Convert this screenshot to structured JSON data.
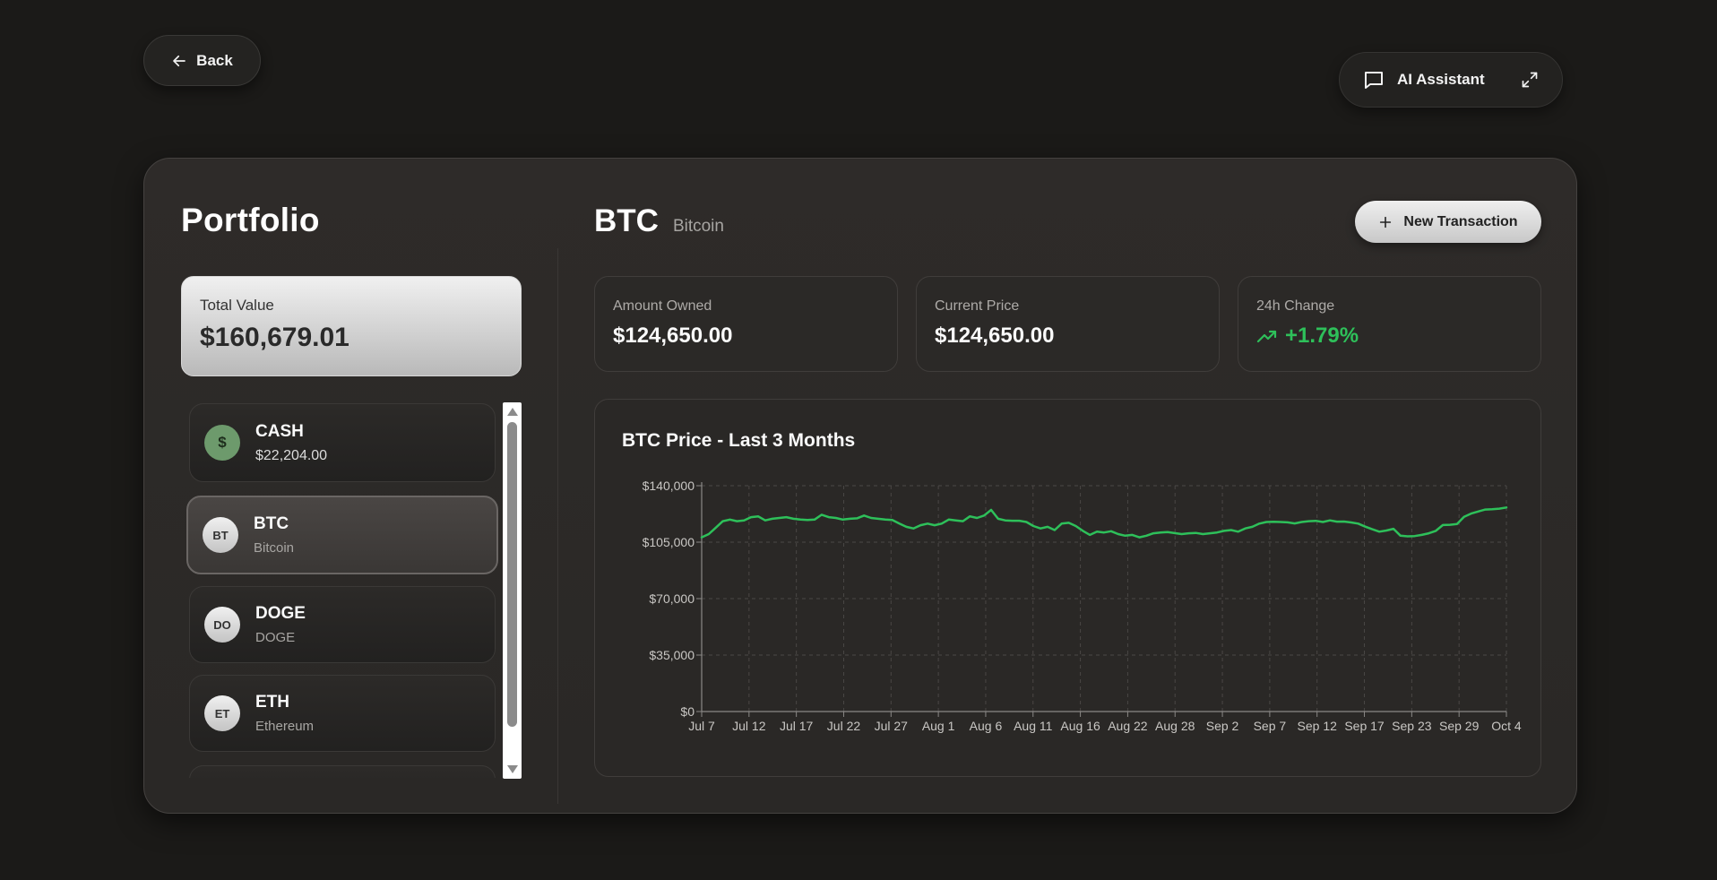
{
  "header": {
    "back_label": "Back",
    "ai_assistant_label": "AI Assistant"
  },
  "portfolio": {
    "title": "Portfolio",
    "total_label": "Total Value",
    "total_value": "$160,679.01",
    "assets": [
      {
        "icon": "$",
        "name": "CASH",
        "sub": "$22,204.00"
      },
      {
        "icon": "BT",
        "name": "BTC",
        "sub": "Bitcoin",
        "selected": true
      },
      {
        "icon": "DO",
        "name": "DOGE",
        "sub": "DOGE"
      },
      {
        "icon": "ET",
        "name": "ETH",
        "sub": "Ethereum"
      }
    ]
  },
  "coin": {
    "symbol": "BTC",
    "name": "Bitcoin",
    "new_transaction_label": "New Transaction"
  },
  "stats": {
    "amount_owned_label": "Amount Owned",
    "amount_owned_value": "$124,650.00",
    "current_price_label": "Current Price",
    "current_price_value": "$124,650.00",
    "change_label": "24h Change",
    "change_value": "+1.79%"
  },
  "colors": {
    "accent_green": "#2ec05a",
    "chart_line": "#2ec05a"
  },
  "chart_data": {
    "type": "line",
    "title": "BTC Price - Last 3 Months",
    "xlabel": "",
    "ylabel": "",
    "ylim": [
      0,
      140000
    ],
    "yticks": [
      {
        "value": 0,
        "label": "$0"
      },
      {
        "value": 35000,
        "label": "$35,000"
      },
      {
        "value": 70000,
        "label": "$70,000"
      },
      {
        "value": 105000,
        "label": "$105,000"
      },
      {
        "value": 140000,
        "label": "$140,000"
      }
    ],
    "xticks": [
      "Jul 7",
      "Jul 12",
      "Jul 17",
      "Jul 22",
      "Jul 27",
      "Aug 1",
      "Aug 6",
      "Aug 11",
      "Aug 16",
      "Aug 22",
      "Aug 28",
      "Sep 2",
      "Sep 7",
      "Sep 12",
      "Sep 17",
      "Sep 23",
      "Sep 29",
      "Oct 4"
    ],
    "grid": true,
    "series": [
      {
        "values": [
          108000,
          110000,
          114000,
          118000,
          119000,
          118000,
          118500,
          120500,
          121000,
          118500,
          119500,
          120000,
          120500,
          119500,
          119000,
          118800,
          119000,
          122000,
          120500,
          120000,
          119000,
          119500,
          119800,
          121500,
          120000,
          119500,
          119000,
          118700,
          116500,
          114500,
          113500,
          115500,
          116500,
          115500,
          116500,
          119000,
          118500,
          118000,
          121000,
          120000,
          121500,
          125000,
          119500,
          118500,
          118300,
          118300,
          117500,
          115000,
          113500,
          114500,
          112500,
          116500,
          117000,
          115000,
          112000,
          109500,
          111500,
          111000,
          111800,
          110000,
          109000,
          109500,
          108000,
          109000,
          110500,
          111000,
          111200,
          110600,
          110000,
          110500,
          110700,
          110000,
          110500,
          111000,
          112000,
          112500,
          111500,
          113500,
          114500,
          116500,
          117500,
          117600,
          117500,
          117300,
          116600,
          117500,
          118000,
          118200,
          117500,
          118500,
          117700,
          117800,
          117200,
          116500,
          114600,
          113000,
          111500,
          112200,
          113300,
          109000,
          108600,
          108800,
          109500,
          110500,
          112000,
          115600,
          115800,
          116200,
          120700,
          122700,
          124000,
          125200,
          125400,
          125800,
          126500
        ]
      }
    ]
  }
}
